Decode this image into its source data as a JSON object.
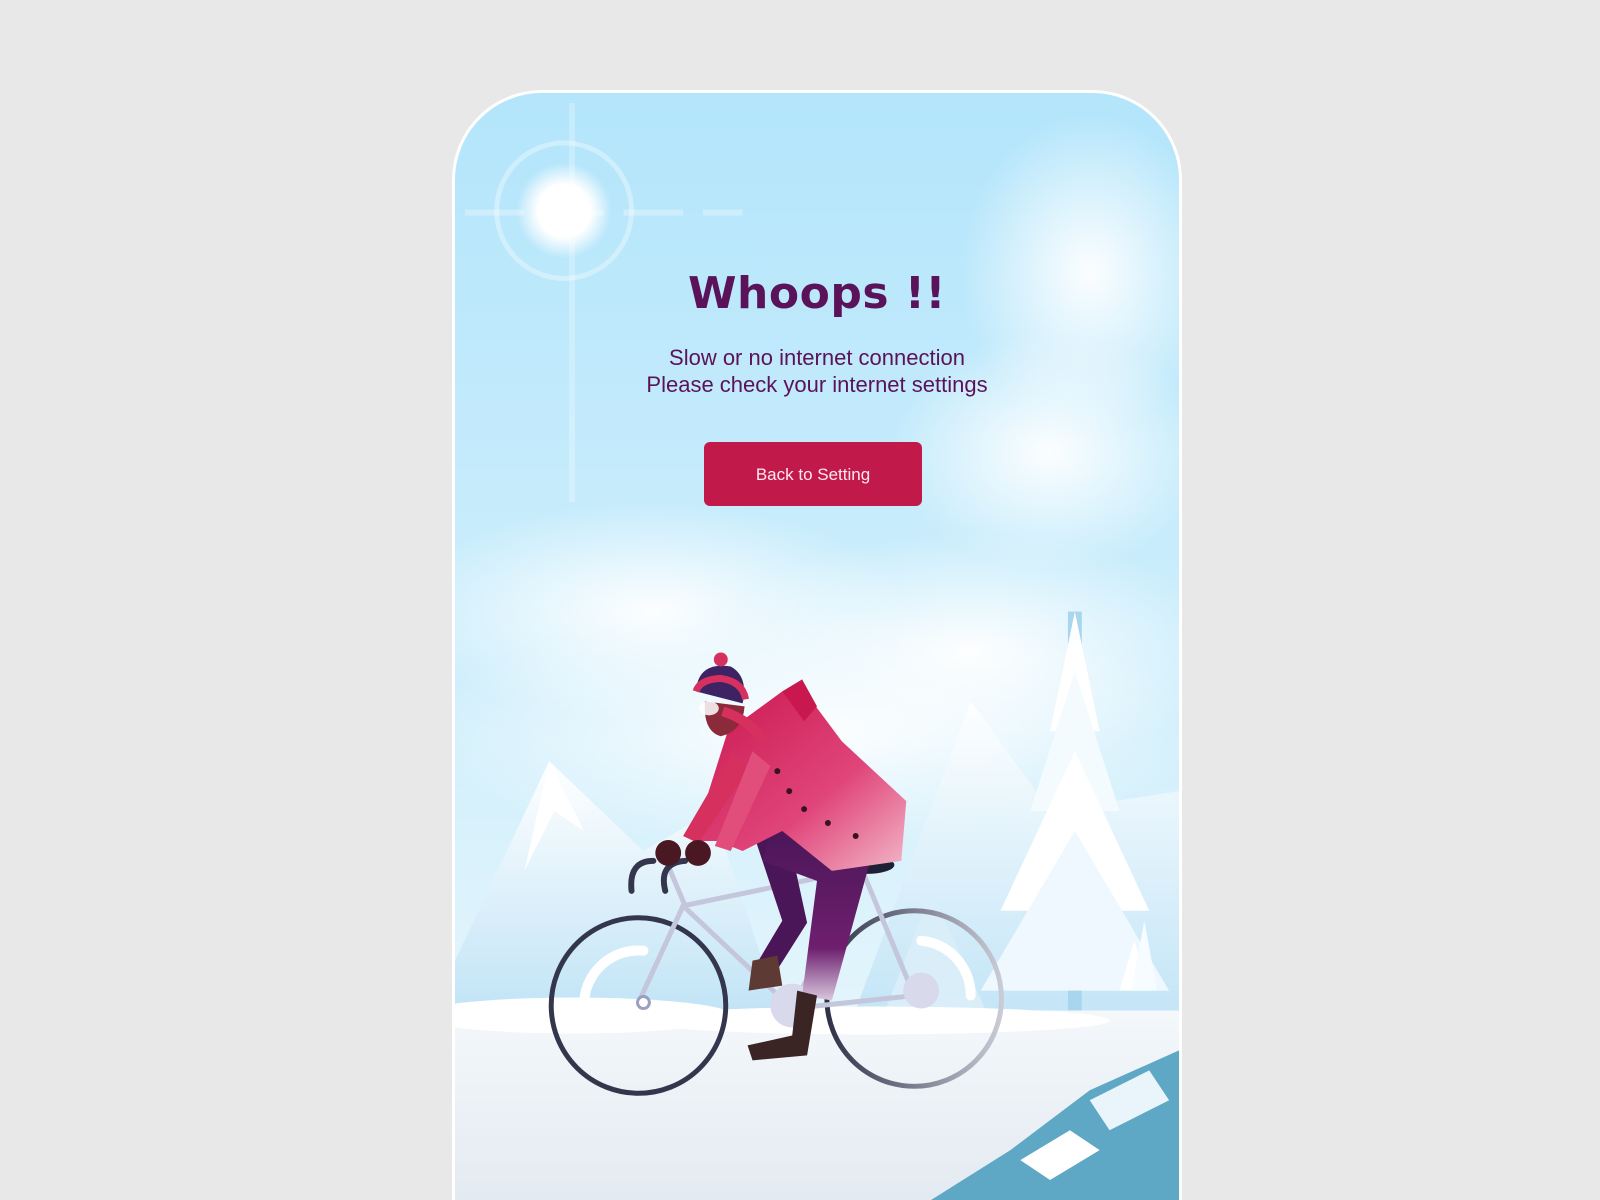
{
  "screen": {
    "title": "Whoops !!",
    "message_line1": "Slow or no internet connection",
    "message_line2": "Please check your internet settings",
    "button_label": "Back to Setting"
  },
  "colors": {
    "page_bg": "#e8e8e8",
    "sky": "#b3e5fb",
    "title": "#5a1358",
    "button": "#c11a4a",
    "button_text": "#ffe9ef",
    "jacket": "#d4265f",
    "pants": "#5e1a66",
    "river": "#5ea8c6"
  },
  "illustration": {
    "subject": "cyclist riding through snowy mountains",
    "icons": [
      "sun-icon",
      "mountain-icon",
      "pine-tree-icon",
      "bicycle-icon",
      "cyclist-icon"
    ]
  }
}
